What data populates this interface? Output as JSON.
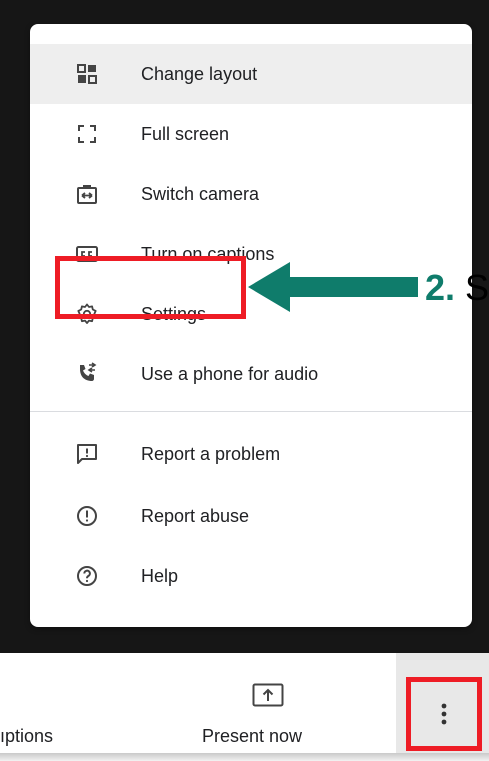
{
  "menu": {
    "items": [
      {
        "label": "Change layout",
        "icon": "change-layout-icon",
        "highlighted": true
      },
      {
        "label": "Full screen",
        "icon": "fullscreen-icon"
      },
      {
        "label": "Switch camera",
        "icon": "switch-camera-icon"
      },
      {
        "label": "Turn on captions",
        "icon": "captions-icon"
      },
      {
        "label": "Settings",
        "icon": "gear-icon"
      },
      {
        "label": "Use a phone for audio",
        "icon": "phone-audio-icon"
      },
      {
        "label": "Report a problem",
        "icon": "report-problem-icon"
      },
      {
        "label": "Report abuse",
        "icon": "report-abuse-icon"
      },
      {
        "label": "Help",
        "icon": "help-icon"
      }
    ]
  },
  "annotation": {
    "step_number": "2.",
    "step_text": "S",
    "highlight_color": "#ee1c25",
    "arrow_color": "#0f7c6b"
  },
  "bottom_bar": {
    "captions_label": "ıptions",
    "present_label": "Present now",
    "present_icon": "present-screen-icon",
    "more_icon": "more-vert-icon"
  }
}
